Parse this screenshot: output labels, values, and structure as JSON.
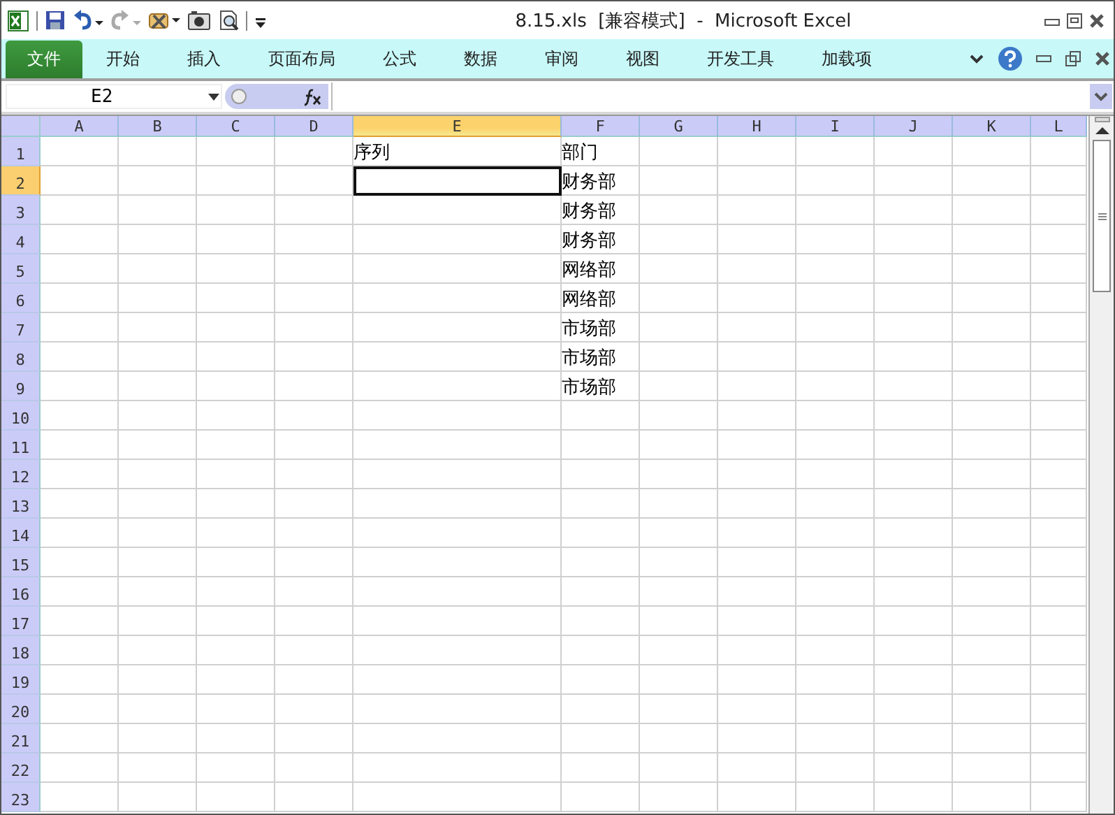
{
  "window": {
    "title": "8.15.xls  [兼容模式]  -  Microsoft Excel"
  },
  "ribbon_tabs": [
    {
      "label": "文件",
      "kind": "file"
    },
    {
      "label": "开始",
      "kind": "tab"
    },
    {
      "label": "插入",
      "kind": "tab"
    },
    {
      "label": "页面布局",
      "kind": "tab"
    },
    {
      "label": "公式",
      "kind": "tab"
    },
    {
      "label": "数据",
      "kind": "tab"
    },
    {
      "label": "审阅",
      "kind": "tab"
    },
    {
      "label": "视图",
      "kind": "tab"
    },
    {
      "label": "开发工具",
      "kind": "tab"
    },
    {
      "label": "加载项",
      "kind": "tab"
    }
  ],
  "formula_bar": {
    "name_box": "E2"
  },
  "columns": [
    {
      "label": "A",
      "selected": false
    },
    {
      "label": "B",
      "selected": false
    },
    {
      "label": "C",
      "selected": false
    },
    {
      "label": "D",
      "selected": false
    },
    {
      "label": "E",
      "selected": true
    },
    {
      "label": "F",
      "selected": false
    },
    {
      "label": "G",
      "selected": false
    },
    {
      "label": "H",
      "selected": false
    },
    {
      "label": "I",
      "selected": false
    },
    {
      "label": "J",
      "selected": false
    },
    {
      "label": "K",
      "selected": false
    },
    {
      "label": "L",
      "selected": false
    }
  ],
  "rows": [
    {
      "label": "1",
      "selected": false,
      "cells": [
        null,
        null,
        null,
        null,
        "序列",
        "部门"
      ]
    },
    {
      "label": "2",
      "selected": true,
      "cells": [
        null,
        null,
        null,
        null,
        null,
        "财务部"
      ]
    },
    {
      "label": "3",
      "selected": false,
      "cells": [
        null,
        null,
        null,
        null,
        null,
        "财务部"
      ]
    },
    {
      "label": "4",
      "selected": false,
      "cells": [
        null,
        null,
        null,
        null,
        null,
        "财务部"
      ]
    },
    {
      "label": "5",
      "selected": false,
      "cells": [
        null,
        null,
        null,
        null,
        null,
        "网络部"
      ]
    },
    {
      "label": "6",
      "selected": false,
      "cells": [
        null,
        null,
        null,
        null,
        null,
        "网络部"
      ]
    },
    {
      "label": "7",
      "selected": false,
      "cells": [
        null,
        null,
        null,
        null,
        null,
        "市场部"
      ]
    },
    {
      "label": "8",
      "selected": false,
      "cells": [
        null,
        null,
        null,
        null,
        null,
        "市场部"
      ]
    },
    {
      "label": "9",
      "selected": false,
      "cells": [
        null,
        null,
        null,
        null,
        null,
        "市场部"
      ]
    },
    {
      "label": "10",
      "selected": false
    },
    {
      "label": "11",
      "selected": false
    },
    {
      "label": "12",
      "selected": false
    },
    {
      "label": "13",
      "selected": false
    },
    {
      "label": "14",
      "selected": false
    },
    {
      "label": "15",
      "selected": false
    },
    {
      "label": "16",
      "selected": false
    },
    {
      "label": "17",
      "selected": false
    },
    {
      "label": "18",
      "selected": false
    },
    {
      "label": "19",
      "selected": false
    },
    {
      "label": "20",
      "selected": false
    },
    {
      "label": "21",
      "selected": false
    },
    {
      "label": "22",
      "selected": false
    },
    {
      "label": "23",
      "selected": false
    }
  ]
}
